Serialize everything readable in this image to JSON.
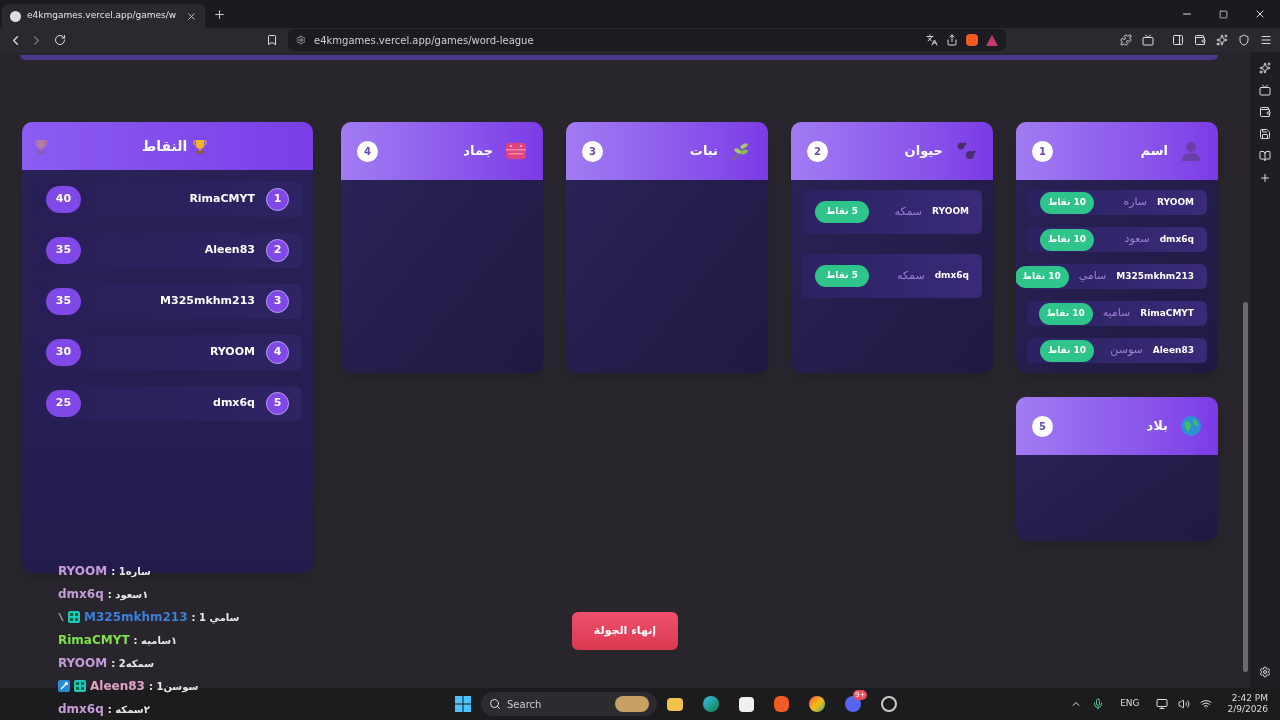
{
  "browser": {
    "tab_title": "e4kmgames.vercel.app/games/w",
    "url": "e4kmgames.vercel.app/games/word-league"
  },
  "leaderboard": {
    "title": "النقاط",
    "rows": [
      {
        "rank": "1",
        "name": "RimaCMYT",
        "score": "40"
      },
      {
        "rank": "2",
        "name": "Aleen83",
        "score": "35"
      },
      {
        "rank": "3",
        "name": "M325mkhm213",
        "score": "35"
      },
      {
        "rank": "4",
        "name": "RYOOM",
        "score": "30"
      },
      {
        "rank": "5",
        "name": "dmx6q",
        "score": "25"
      }
    ]
  },
  "categories": [
    {
      "number": "1",
      "title": "اسم",
      "answers": [
        {
          "player": "RYOOM",
          "answer": "ساره",
          "points": "10 نقاط"
        },
        {
          "player": "dmx6q",
          "answer": "سعود",
          "points": "10 نقاط"
        },
        {
          "player": "M325mkhm213",
          "answer": "سامي",
          "points": "10 نقاط"
        },
        {
          "player": "RimaCMYT",
          "answer": "ساميه",
          "points": "10 نقاط"
        },
        {
          "player": "Aleen83",
          "answer": "سوسن",
          "points": "10 نقاط"
        }
      ]
    },
    {
      "number": "2",
      "title": "حيوان",
      "answers": [
        {
          "player": "RYOOM",
          "answer": "سمكه",
          "points": "5 نقاط"
        },
        {
          "player": "dmx6q",
          "answer": "سمكه",
          "points": "5 نقاط"
        }
      ]
    },
    {
      "number": "3",
      "title": "نبات"
    },
    {
      "number": "4",
      "title": "جماد"
    },
    {
      "number": "5",
      "title": "بلاد"
    }
  ],
  "end_round_button": "إنهاء الجولة",
  "chat": [
    {
      "kind": "plain",
      "user": "RYOOM",
      "text": ": ساره1",
      "color": "#c49ad8"
    },
    {
      "kind": "plain",
      "user": "dmx6q",
      "text": ": ١سعود",
      "color": "#c49ad8"
    },
    {
      "kind": "mod",
      "user": "M325mkhm213",
      "text": ": سامي 1",
      "color": "#3b7fd9"
    },
    {
      "kind": "plain",
      "user": "RimaCMYT",
      "text": ": ١ساميه",
      "color": "#7fe04a"
    },
    {
      "kind": "plain",
      "user": "RYOOM",
      "text": ": سمكه2",
      "color": "#c49ad8"
    },
    {
      "kind": "vip",
      "user": "Aleen83",
      "text": ": سوسن1",
      "color": "#e4a3c2"
    },
    {
      "kind": "plain",
      "user": "dmx6q",
      "text": ": ٢سمكه",
      "color": "#c49ad8"
    }
  ],
  "taskbar": {
    "search": "Search",
    "notification_count": "9+",
    "language": "ENG",
    "time": "2:42 PM",
    "date": "2/9/2026"
  }
}
